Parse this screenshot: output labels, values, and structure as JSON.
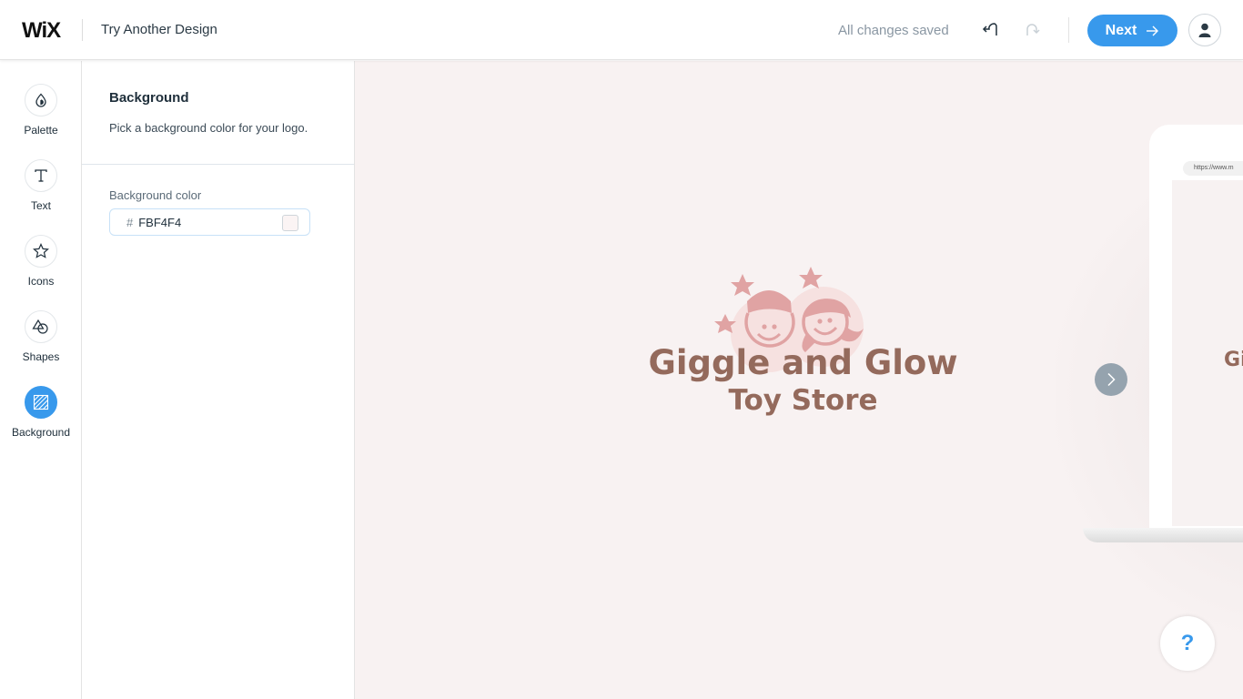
{
  "header": {
    "logo_text": "WiX",
    "title": "Try Another Design",
    "save_status": "All changes saved",
    "next_label": "Next",
    "accent_color": "#3899ec"
  },
  "rail": {
    "items": [
      {
        "label": "Palette",
        "icon": "drop-icon",
        "active": false
      },
      {
        "label": "Text",
        "icon": "text-t-icon",
        "active": false
      },
      {
        "label": "Icons",
        "icon": "star-icon",
        "active": false
      },
      {
        "label": "Shapes",
        "icon": "shapes-icon",
        "active": false
      },
      {
        "label": "Background",
        "icon": "background-hatch-icon",
        "active": true
      }
    ]
  },
  "panel": {
    "title": "Background",
    "description": "Pick a background color for your logo.",
    "field_label": "Background color",
    "hash": "#",
    "hex_value": "FBF4F4",
    "swatch_color": "#FBF4F4"
  },
  "canvas": {
    "background_color": "#F8F2F2",
    "brand_name": "Giggle and Glow",
    "brand_sub": "Toy Store",
    "brand_color": "#946A5C",
    "icon_color": "#E0A3A3",
    "laptop_url": "https://www.m",
    "laptop_text": "Gi"
  },
  "help": {
    "label": "?"
  }
}
